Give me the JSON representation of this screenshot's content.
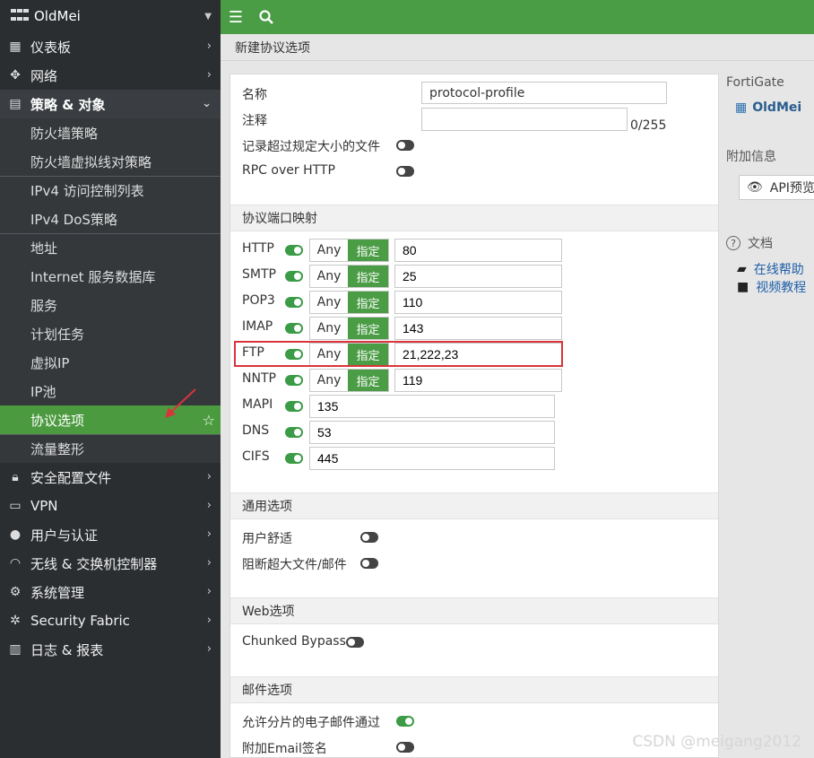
{
  "brand": {
    "name": "OldMei"
  },
  "sidebar": {
    "items": [
      {
        "label": "仪表板",
        "icon": "dashboard-icon"
      },
      {
        "label": "网络",
        "icon": "network-icon"
      },
      {
        "label": "策略 & 对象",
        "icon": "policy-icon"
      },
      {
        "label": "安全配置文件",
        "icon": "lock-icon"
      },
      {
        "label": "VPN",
        "icon": "laptop-icon"
      },
      {
        "label": "用户与认证",
        "icon": "user-icon"
      },
      {
        "label": "无线 & 交换机控制器",
        "icon": "wifi-icon"
      },
      {
        "label": "系统管理",
        "icon": "gear-icon"
      },
      {
        "label": "Security Fabric",
        "icon": "fabric-icon"
      },
      {
        "label": "日志 & 报表",
        "icon": "chart-icon"
      }
    ],
    "sub_items": [
      "防火墙策略",
      "防火墙虚拟线对策略",
      "IPv4 访问控制列表",
      "IPv4 DoS策略",
      "地址",
      "Internet 服务数据库",
      "服务",
      "计划任务",
      "虚拟IP",
      "IP池",
      "协议选项",
      "流量整形"
    ]
  },
  "page": {
    "title": "新建协议选项"
  },
  "form": {
    "name_label": "名称",
    "name_value": "protocol-profile",
    "comment_label": "注释",
    "comment_counter": "0/255",
    "log_oversized_label": "记录超过规定大小的文件",
    "rpc_label": "RPC over HTTP"
  },
  "sections": {
    "port_mapping": "协议端口映射",
    "common": "通用选项",
    "web": "Web选项",
    "mail": "邮件选项"
  },
  "ports": {
    "any_label": "Any",
    "specify_label": "指定",
    "rows": [
      {
        "proto": "HTTP",
        "value": "80"
      },
      {
        "proto": "SMTP",
        "value": "25"
      },
      {
        "proto": "POP3",
        "value": "110"
      },
      {
        "proto": "IMAP",
        "value": "143"
      },
      {
        "proto": "FTP",
        "value": "21,222,23"
      },
      {
        "proto": "NNTP",
        "value": "119"
      },
      {
        "proto": "MAPI",
        "value": "135"
      },
      {
        "proto": "DNS",
        "value": "53"
      },
      {
        "proto": "CIFS",
        "value": "445"
      }
    ]
  },
  "common": {
    "comfort_label": "用户舒适",
    "block_oversize_label": "阻断超大文件/邮件"
  },
  "web": {
    "chunked_label": "Chunked Bypass"
  },
  "mail": {
    "fragmented_label": "允许分片的电子邮件通过",
    "signature_label": "附加Email签名"
  },
  "rightpanel": {
    "device_label": "FortiGate",
    "device_name": "OldMei",
    "extra_info": "附加信息",
    "api_preview": "API预览",
    "docs_label": "文档",
    "online_help": "在线帮助",
    "video_tutorials": "视频教程"
  },
  "watermark": "CSDN @meigang2012",
  "colors": {
    "accent": "#4a9c45",
    "sidebar": "#2b2e31",
    "highlight": "#d9343b"
  }
}
